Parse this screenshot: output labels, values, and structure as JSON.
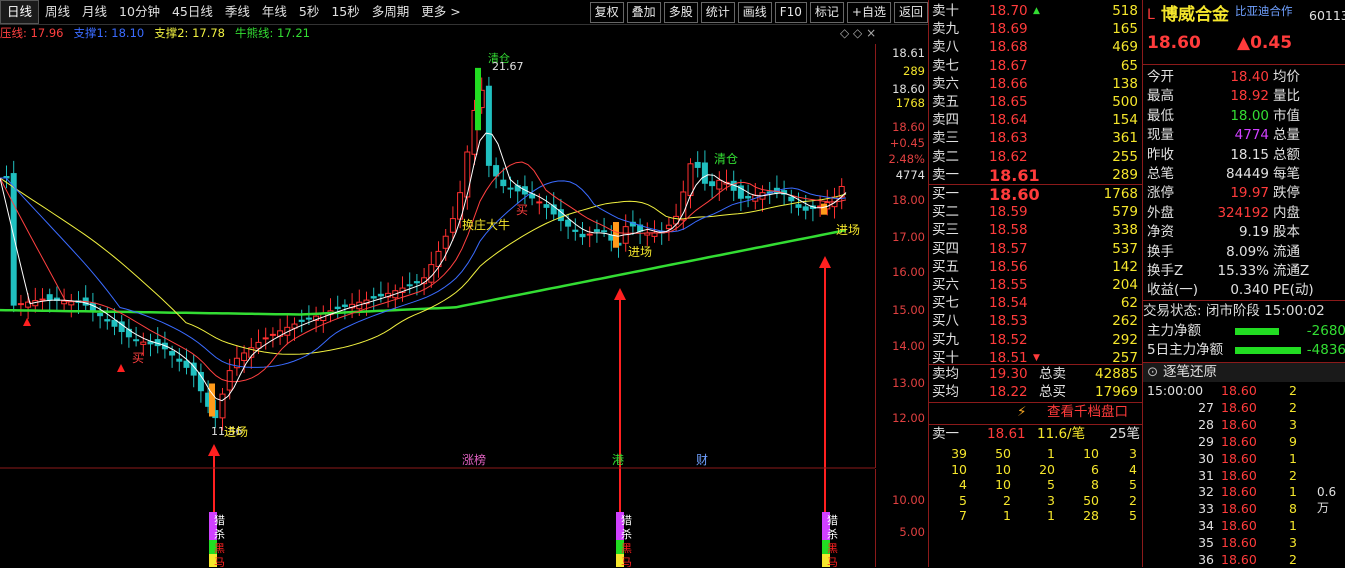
{
  "toolbar": {
    "periods": [
      "日线",
      "周线",
      "月线",
      "10分钟",
      "45日线",
      "季线",
      "年线",
      "5秒",
      "15秒",
      "多周期",
      "更多"
    ],
    "tools": [
      "复权",
      "叠加",
      "多股",
      "统计",
      "画线",
      "F10",
      "标记",
      "+自选",
      "返回"
    ]
  },
  "ma_legend": [
    {
      "text": "压线: 17.96",
      "color": "#ff4040"
    },
    {
      "text": "支撑1: 18.10",
      "color": "#3a6bff"
    },
    {
      "text": "支撑2: 17.78",
      "color": "#f0f040"
    },
    {
      "text": "牛熊线: 17.21",
      "color": "#33dd33"
    }
  ],
  "chart_controls": "◇ ◇ ×",
  "chart_annotations": {
    "qingcang1": "清仓",
    "high": "21.67",
    "huanzhuang": "换庄大牛",
    "mai": "买",
    "mai2": "买",
    "qingcang2": "清仓",
    "jinchang": "进场",
    "low": "11.56",
    "bottom_labels": [
      "涨榜",
      "港",
      "财"
    ],
    "signal_col": [
      "猎",
      "杀",
      "黑",
      "马"
    ]
  },
  "price_axis": {
    "ticks": [
      "18.61",
      "289",
      "18.60",
      "1768",
      "18.60",
      "+0.45",
      "2.48%",
      "4774",
      "18.00",
      "17.00",
      "16.00",
      "15.00",
      "14.00",
      "13.00",
      "12.00"
    ],
    "lower_ticks": [
      "10.00",
      "5.00"
    ]
  },
  "book": {
    "sell": [
      {
        "label": "卖十",
        "price": "18.70",
        "vol": "518",
        "mark": "▲"
      },
      {
        "label": "卖九",
        "price": "18.69",
        "vol": "165"
      },
      {
        "label": "卖八",
        "price": "18.68",
        "vol": "469"
      },
      {
        "label": "卖七",
        "price": "18.67",
        "vol": "65"
      },
      {
        "label": "卖六",
        "price": "18.66",
        "vol": "138"
      },
      {
        "label": "卖五",
        "price": "18.65",
        "vol": "500"
      },
      {
        "label": "卖四",
        "price": "18.64",
        "vol": "154"
      },
      {
        "label": "卖三",
        "price": "18.63",
        "vol": "361"
      },
      {
        "label": "卖二",
        "price": "18.62",
        "vol": "255"
      },
      {
        "label": "卖一",
        "price": "18.61",
        "vol": "289"
      }
    ],
    "buy": [
      {
        "label": "买一",
        "price": "18.60",
        "vol": "1768"
      },
      {
        "label": "买二",
        "price": "18.59",
        "vol": "579"
      },
      {
        "label": "买三",
        "price": "18.58",
        "vol": "338"
      },
      {
        "label": "买四",
        "price": "18.57",
        "vol": "537"
      },
      {
        "label": "买五",
        "price": "18.56",
        "vol": "142"
      },
      {
        "label": "买六",
        "price": "18.55",
        "vol": "204"
      },
      {
        "label": "买七",
        "price": "18.54",
        "vol": "62"
      },
      {
        "label": "买八",
        "price": "18.53",
        "vol": "262"
      },
      {
        "label": "买九",
        "price": "18.52",
        "vol": "292"
      },
      {
        "label": "买十",
        "price": "18.51",
        "vol": "257",
        "mark": "▼"
      }
    ],
    "sell_avg": {
      "label": "卖均",
      "price": "19.30",
      "tlabel": "总卖",
      "vol": "42885"
    },
    "buy_avg": {
      "label": "买均",
      "price": "18.22",
      "tlabel": "总买",
      "vol": "17969"
    },
    "thousand_btn": "查看千档盘口",
    "queue_head": {
      "label": "卖一",
      "price": "18.61",
      "per": "11.6/笔",
      "cnt": "25笔"
    },
    "queue": [
      [
        "39",
        "50",
        "1",
        "10",
        "3"
      ],
      [
        "10",
        "10",
        "20",
        "6",
        "4"
      ],
      [
        "4",
        "10",
        "5",
        "8",
        "5"
      ],
      [
        "5",
        "2",
        "3",
        "50",
        "2"
      ],
      [
        "7",
        "1",
        "1",
        "28",
        "5"
      ]
    ]
  },
  "info": {
    "badge": "L",
    "name": "博威合金",
    "tag": "比亚迪合作",
    "code": "601137",
    "price": "18.60",
    "change": "▲0.45",
    "rows": [
      {
        "l": "今开",
        "v": "18.40",
        "vc": "#ff3b3b",
        "l2": "均价"
      },
      {
        "l": "最高",
        "v": "18.92",
        "vc": "#ff3b3b",
        "l2": "量比"
      },
      {
        "l": "最低",
        "v": "18.00",
        "vc": "#33dd33",
        "l2": "市值"
      },
      {
        "l": "现量",
        "v": "4774",
        "vc": "#d040ff",
        "l2": "总量"
      },
      {
        "l": "昨收",
        "v": "18.15",
        "vc": "#e0e0e0",
        "l2": "总额"
      },
      {
        "l": "总笔",
        "v": "84449",
        "vc": "#e0e0e0",
        "l2": "每笔"
      },
      {
        "l": "涨停",
        "v": "19.97",
        "vc": "#ff3b3b",
        "l2": "跌停"
      },
      {
        "l": "外盘",
        "v": "324192",
        "vc": "#ff3b3b",
        "l2": "内盘"
      },
      {
        "l": "净资",
        "v": "9.19",
        "vc": "#e0e0e0",
        "l2": "股本"
      },
      {
        "l": "换手",
        "v": "8.09%",
        "vc": "#e0e0e0",
        "l2": "流通"
      },
      {
        "l": "换手Z",
        "v": "15.33%",
        "vc": "#e0e0e0",
        "l2": "流通Z"
      },
      {
        "l": "收益(一)",
        "v": "0.340",
        "vc": "#e0e0e0",
        "l2": "PE(动)"
      }
    ],
    "trade_status": "交易状态: 闭市阶段 15:00:02",
    "main_flow": {
      "label": "主力净额",
      "value": "-2680"
    },
    "main_flow5": {
      "label": "5日主力净额",
      "value": "-4836"
    },
    "restore": "逐笔还原",
    "ticks": [
      {
        "t": "15:00:00",
        "p": "18.60",
        "v": "2"
      },
      {
        "t": "27",
        "p": "18.60",
        "v": "2"
      },
      {
        "t": "28",
        "p": "18.60",
        "v": "3"
      },
      {
        "t": "29",
        "p": "18.60",
        "v": "9"
      },
      {
        "t": "30",
        "p": "18.60",
        "v": "1"
      },
      {
        "t": "31",
        "p": "18.60",
        "v": "2"
      },
      {
        "t": "32",
        "p": "18.60",
        "v": "1"
      },
      {
        "t": "33",
        "p": "18.60",
        "v": "8"
      },
      {
        "t": "34",
        "p": "18.60",
        "v": "1"
      },
      {
        "t": "35",
        "p": "18.60",
        "v": "3"
      },
      {
        "t": "36",
        "p": "18.60",
        "v": "2"
      }
    ],
    "big_order": "0.6万"
  }
}
